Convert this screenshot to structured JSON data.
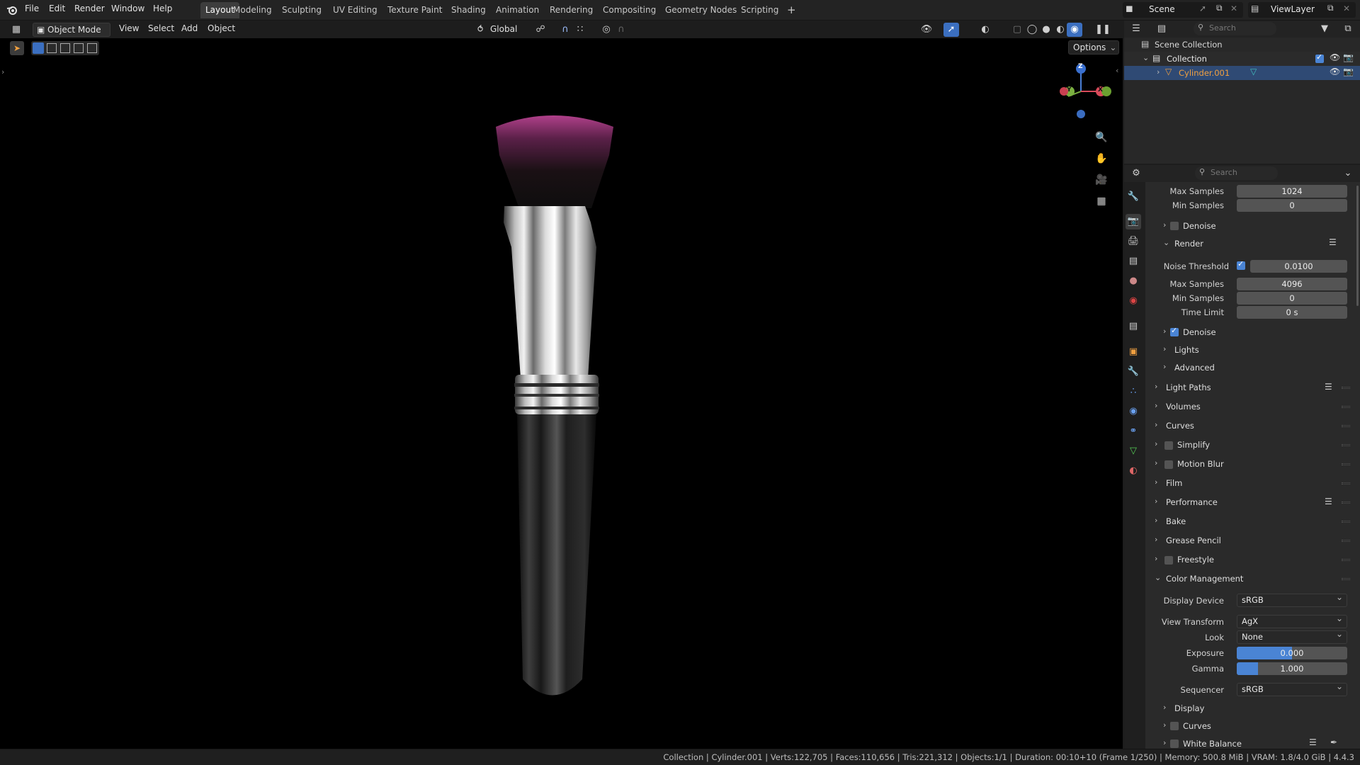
{
  "topbar": {
    "menus": [
      "File",
      "Edit",
      "Render",
      "Window",
      "Help"
    ],
    "workspaces": [
      "Layout",
      "Modeling",
      "Sculpting",
      "UV Editing",
      "Texture Paint",
      "Shading",
      "Animation",
      "Rendering",
      "Compositing",
      "Geometry Nodes",
      "Scripting"
    ],
    "active_workspace": "Layout",
    "add_tab": "+",
    "scene": "Scene",
    "view_layer": "ViewLayer"
  },
  "viewport": {
    "mode": "Object Mode",
    "menus": [
      "View",
      "Select",
      "Add",
      "Object"
    ],
    "orientation": "Global",
    "options": "Options",
    "gizmo": {
      "z": "Z",
      "y": "Y",
      "x": "X"
    }
  },
  "outliner": {
    "search_placeholder": "Search",
    "scene_collection": "Scene Collection",
    "collection": "Collection",
    "object": "Cylinder.001"
  },
  "properties": {
    "search_placeholder": "Search",
    "top_max_samples_label": "Max Samples",
    "top_max_samples": "1024",
    "top_min_samples_label": "Min Samples",
    "top_min_samples": "0",
    "denoise_viewport": "Denoise",
    "render": "Render",
    "noise_threshold_label": "Noise Threshold",
    "noise_threshold": "0.0100",
    "max_samples_label": "Max Samples",
    "max_samples": "4096",
    "min_samples_label": "Min Samples",
    "min_samples": "0",
    "time_limit_label": "Time Limit",
    "time_limit": "0 s",
    "denoise_render": "Denoise",
    "lights": "Lights",
    "advanced": "Advanced",
    "panels": [
      "Light Paths",
      "Volumes",
      "Curves",
      "Simplify",
      "Motion Blur",
      "Film",
      "Performance",
      "Bake",
      "Grease Pencil",
      "Freestyle"
    ],
    "color_management": "Color Management",
    "display_device_label": "Display Device",
    "display_device": "sRGB",
    "view_transform_label": "View Transform",
    "view_transform": "AgX",
    "look_label": "Look",
    "look": "None",
    "exposure_label": "Exposure",
    "exposure": "0.000",
    "exposure_fill": 0.5,
    "gamma_label": "Gamma",
    "gamma": "1.000",
    "gamma_fill": 0.19,
    "sequencer_label": "Sequencer",
    "sequencer": "sRGB",
    "display": "Display",
    "curves_sub": "Curves",
    "white_balance": "White Balance"
  },
  "status": {
    "text": "Collection | Cylinder.001 | Verts:122,705 | Faces:110,656 | Tris:221,312 | Objects:1/1 | Duration: 00:10+10 (Frame 1/250) | Memory: 500.8 MiB | VRAM: 1.8/4.0 GiB | 4.4.3"
  },
  "colors": {
    "accent": "#4a84d4",
    "selected_row": "#2f4a74",
    "active_object": "#f0a040",
    "brush_bristle": "#b0408a"
  }
}
